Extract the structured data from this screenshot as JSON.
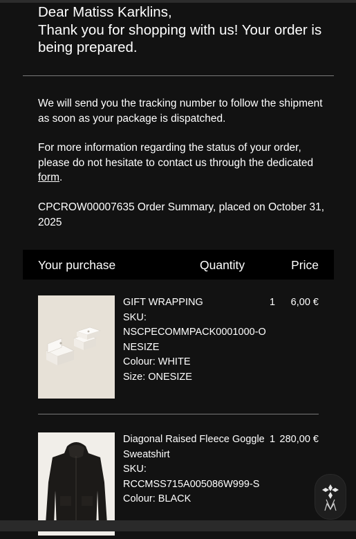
{
  "greeting": {
    "line1": "Dear Matiss Karklins,",
    "line2": "Thank you for shopping with us! Your order is being prepared."
  },
  "body": {
    "tracking_text": "We will send you the tracking number to follow the shipment as soon as your package is dispatched.",
    "info_text": "For more information regarding the status of your order, please do not hesitate to contact us through the dedicated ",
    "form_link": "form",
    "info_end": ".",
    "order_summary": "CPCROW00007635 Order Summary, placed on October 31, 2025"
  },
  "table": {
    "headers": [
      "Your purchase",
      "Quantity",
      "Price"
    ]
  },
  "items": [
    {
      "name": "GIFT WRAPPING",
      "sku_label": "SKU:",
      "sku": "NSCPECOMMPACK0001000-ONESIZE",
      "colour": "Colour: WHITE",
      "size": "Size: ONESIZE",
      "quantity": "1",
      "price": "6,00 €"
    },
    {
      "name": "Diagonal Raised Fleece Goggle Sweatshirt",
      "sku_label": "SKU:",
      "sku": "RCCMSS715A005086W999-S",
      "colour": "Colour: BLACK",
      "quantity": "1",
      "price": "280,00 €"
    }
  ],
  "colors": {
    "background": "#121212",
    "header_bar": "#000000",
    "text": "#ffffff",
    "divider": "#7a7a7a"
  },
  "icons": {
    "fab": "brand-monogram-icon"
  }
}
